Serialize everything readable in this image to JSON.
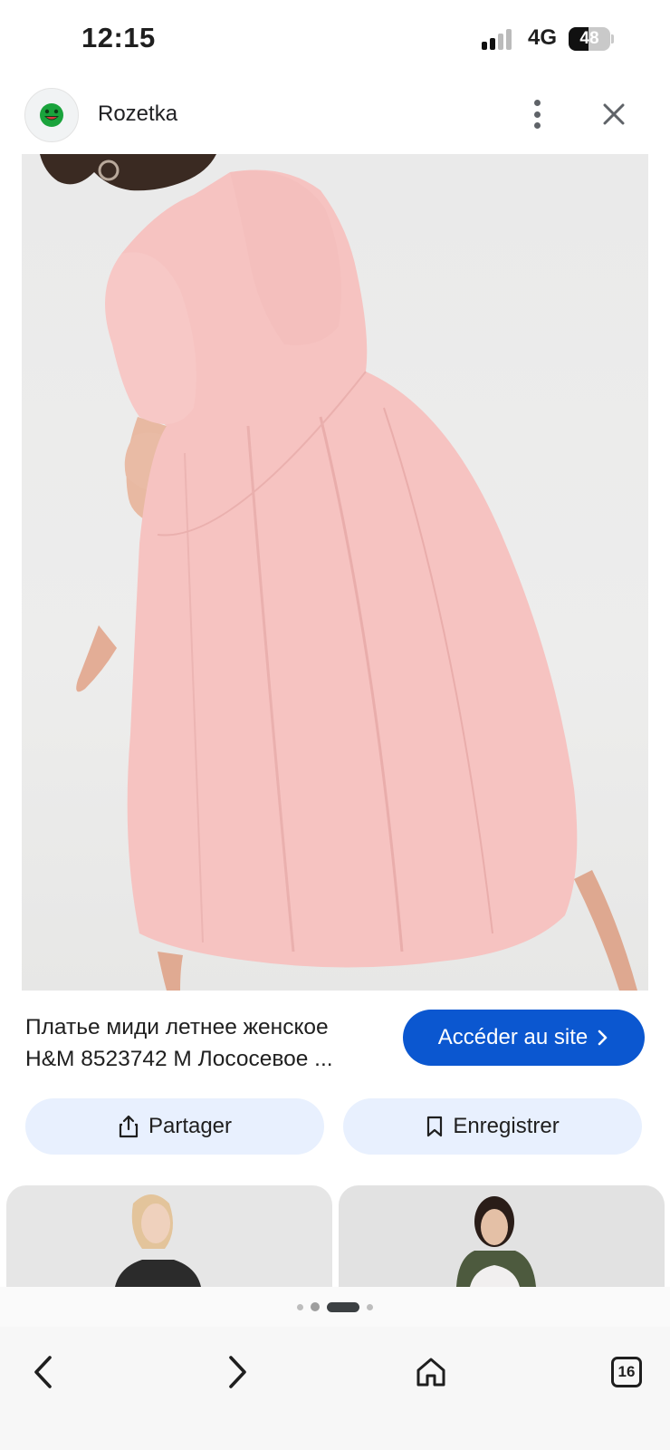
{
  "status_bar": {
    "time": "12:15",
    "network": "4G",
    "battery": "48",
    "battery_level": 0.48
  },
  "header": {
    "site_name": "Rozetka",
    "logo_icon": "rozetka-smiley-logo",
    "menu_icon": "more-vert-icon",
    "close_icon": "close-icon"
  },
  "product": {
    "title_line1": "Платье миди летнее женское",
    "title_line2": "H&M 8523742 M Лососевое ...",
    "visit_label": "Accéder au site",
    "image_icon": "pink-dress-photo"
  },
  "actions": {
    "share_label": "Partager",
    "save_label": "Enregistrer"
  },
  "bottom_nav": {
    "tabs_count": "16"
  },
  "colors": {
    "accent": "#0b57d0",
    "chip_bg": "#e8f0fe",
    "dress": "#f6c3c1"
  }
}
